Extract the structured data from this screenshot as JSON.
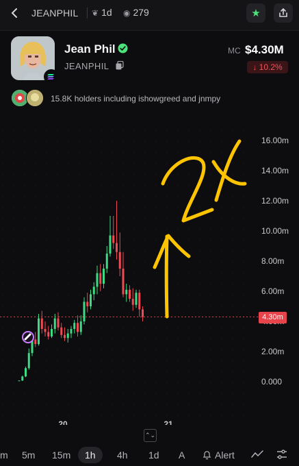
{
  "header": {
    "ticker": "JEANPHIL",
    "age": "1d",
    "views": "279"
  },
  "token": {
    "name": "Jean Phil",
    "symbol": "JEANPHIL",
    "mc_label": "MC",
    "market_cap": "$4.30M",
    "change": "↓ 10.2%"
  },
  "holders": {
    "text": "15.8K holders including ishowgreed and jnmpy"
  },
  "chart_data": {
    "type": "candlestick",
    "y_tick_labels": [
      "16.00m",
      "14.00m",
      "12.00m",
      "10.00m",
      "8.00m",
      "6.00m",
      "4.00m",
      "2.00m",
      "0.000"
    ],
    "x_tick_labels": [
      "20",
      "21"
    ],
    "ylim": [
      0,
      16
    ],
    "current_price_label": "4.30m",
    "current_price": 4.3,
    "annotation": "2X",
    "candles": [
      [
        0.05,
        0.08,
        0.05,
        0.08
      ],
      [
        0.08,
        0.4,
        0.05,
        0.35
      ],
      [
        0.35,
        1.0,
        0.3,
        0.9
      ],
      [
        0.9,
        2.2,
        0.8,
        1.9
      ],
      [
        1.9,
        3.0,
        1.7,
        2.8
      ],
      [
        2.8,
        3.3,
        2.3,
        2.5
      ],
      [
        2.5,
        4.5,
        2.4,
        4.2
      ],
      [
        4.2,
        4.7,
        3.2,
        3.5
      ],
      [
        3.5,
        4.0,
        3.0,
        3.3
      ],
      [
        3.3,
        3.7,
        2.8,
        3.0
      ],
      [
        3.0,
        3.8,
        2.9,
        3.5
      ],
      [
        3.5,
        4.5,
        3.2,
        4.2
      ],
      [
        4.2,
        4.6,
        3.4,
        3.6
      ],
      [
        3.6,
        3.9,
        2.9,
        3.1
      ],
      [
        3.1,
        3.6,
        2.7,
        2.9
      ],
      [
        2.9,
        3.5,
        2.6,
        3.2
      ],
      [
        3.2,
        3.7,
        2.9,
        3.5
      ],
      [
        3.5,
        4.1,
        3.2,
        3.9
      ],
      [
        3.9,
        4.4,
        3.0,
        3.3
      ],
      [
        3.3,
        4.4,
        3.1,
        4.0
      ],
      [
        4.0,
        5.6,
        3.8,
        5.3
      ],
      [
        5.3,
        5.9,
        4.6,
        5.0
      ],
      [
        5.0,
        6.1,
        4.8,
        5.8
      ],
      [
        5.8,
        6.6,
        5.4,
        6.3
      ],
      [
        6.3,
        7.7,
        5.8,
        7.2
      ],
      [
        7.2,
        7.8,
        6.0,
        6.5
      ],
      [
        6.5,
        7.8,
        6.2,
        7.5
      ],
      [
        7.5,
        9.0,
        7.2,
        8.5
      ],
      [
        8.5,
        11.0,
        8.3,
        9.7
      ],
      [
        9.7,
        11.0,
        8.8,
        9.2
      ],
      [
        9.2,
        12.0,
        8.1,
        8.6
      ],
      [
        8.6,
        9.9,
        7.0,
        7.5
      ],
      [
        7.5,
        8.6,
        5.6,
        5.8
      ],
      [
        5.8,
        6.5,
        5.3,
        6.1
      ],
      [
        6.1,
        6.4,
        5.3,
        5.5
      ],
      [
        5.5,
        6.2,
        4.7,
        5.1
      ],
      [
        5.1,
        6.1,
        4.9,
        5.9
      ],
      [
        5.9,
        6.1,
        4.3,
        4.8
      ],
      [
        4.8,
        5.0,
        4.0,
        4.3
      ]
    ]
  },
  "timeframes": [
    "m",
    "5m",
    "15m",
    "1h",
    "4h",
    "1d",
    "A"
  ],
  "active_timeframe": "1h",
  "alert_label": "Alert"
}
